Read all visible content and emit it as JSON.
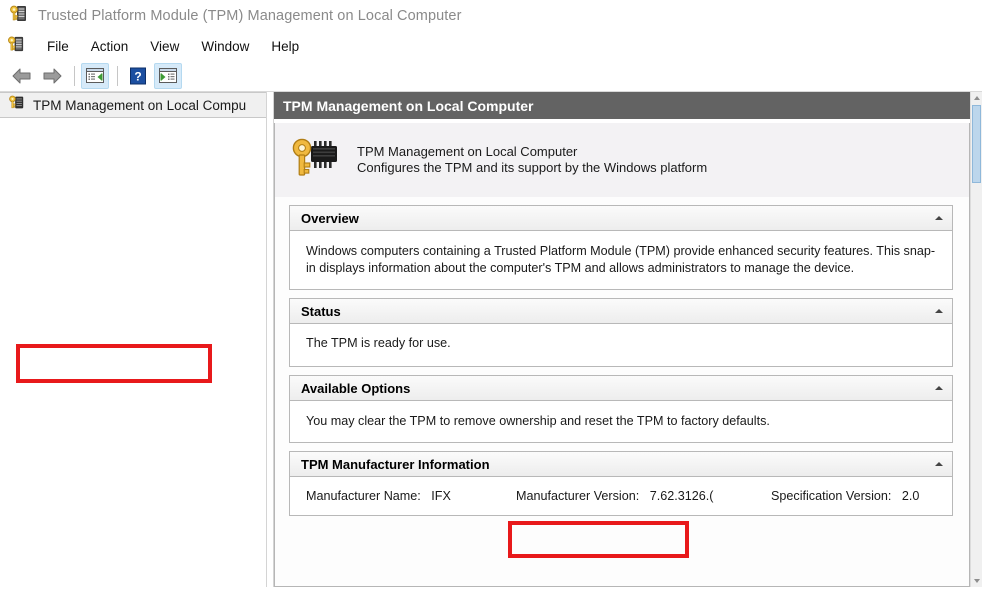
{
  "window": {
    "title": "Trusted Platform Module (TPM) Management on Local Computer",
    "icon": "key-chip-icon"
  },
  "menubar": {
    "icon": "key-chip-icon",
    "items": [
      {
        "label": "File"
      },
      {
        "label": "Action"
      },
      {
        "label": "View"
      },
      {
        "label": "Window"
      },
      {
        "label": "Help"
      }
    ]
  },
  "toolbar": {
    "buttons": [
      {
        "name": "back-button",
        "icon": "left-arrow-icon",
        "state": "normal"
      },
      {
        "name": "forward-button",
        "icon": "right-arrow-icon",
        "state": "normal"
      },
      {
        "name": "show-console-tree-button",
        "icon": "console-tree-icon",
        "state": "active"
      },
      {
        "name": "help-button",
        "icon": "question-mark-icon",
        "state": "normal"
      },
      {
        "name": "show-action-pane-button",
        "icon": "action-pane-icon",
        "state": "active"
      }
    ]
  },
  "tree": {
    "items": [
      {
        "label": "TPM Management on Local Compu",
        "icon": "key-chip-icon",
        "selected": true
      }
    ]
  },
  "panel": {
    "header_title": "TPM Management on Local Computer",
    "banner": {
      "icon": "key-chip-icon",
      "title": "TPM Management on Local Computer",
      "subtitle": "Configures the TPM and its support by the Windows platform"
    },
    "sections": [
      {
        "name": "overview",
        "title": "Overview",
        "collapse_icon": "chevron-up-icon",
        "body": "Windows computers containing a Trusted Platform Module (TPM) provide enhanced security features. This snap-in displays information about the computer's TPM and allows administrators to manage the device."
      },
      {
        "name": "status",
        "title": "Status",
        "collapse_icon": "chevron-up-icon",
        "body": "The TPM is ready for use.",
        "highlighted": true
      },
      {
        "name": "available-options",
        "title": "Available Options",
        "collapse_icon": "chevron-up-icon",
        "body": "You may clear the TPM to remove ownership and reset the TPM to factory defaults."
      },
      {
        "name": "tpm-manufacturer-information",
        "title": "TPM Manufacturer Information",
        "collapse_icon": "chevron-up-icon",
        "fields": [
          {
            "label": "Manufacturer Name:",
            "value": "IFX"
          },
          {
            "label": "Manufacturer Version:",
            "value": "7.62.3126.("
          },
          {
            "label": "Specification Version:",
            "value": "2.0",
            "highlighted": true
          }
        ]
      }
    ]
  },
  "annotations": {
    "color": "#e8191b",
    "boxes": [
      {
        "name": "status-highlight",
        "target": "The TPM is ready for use."
      },
      {
        "name": "spec-version-highlight",
        "target": "Specification Version: 2.0"
      }
    ]
  },
  "scrollbar": {
    "up_icon": "triangle-up-icon",
    "down_icon": "triangle-down-icon"
  }
}
